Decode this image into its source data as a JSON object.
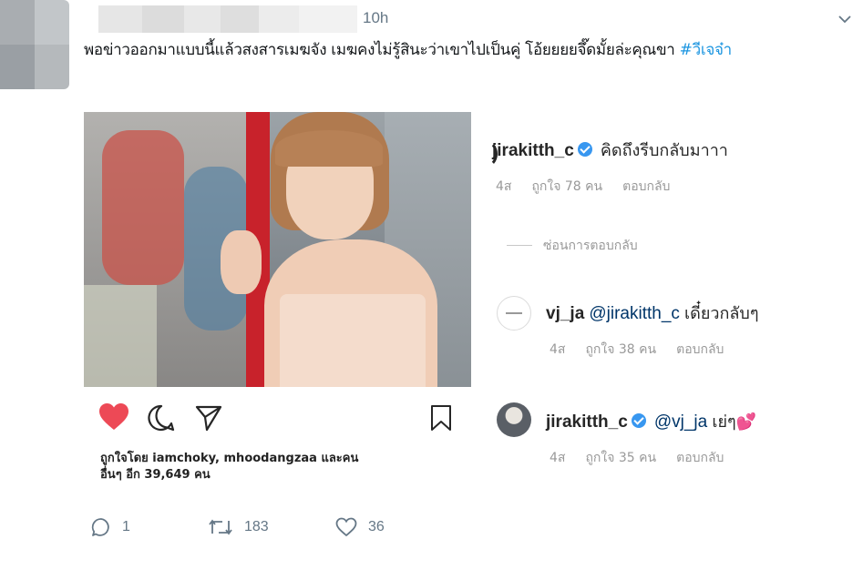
{
  "tweet": {
    "time": "10h",
    "text": "พอข่าวออกมาแบบนี้แล้วสงสารเมฆจัง เมฆคงไม่รู้สินะว่าเขาไปเป็นคู่ โอ้ยยยยจึ๊ดมั้ยล่ะคุณขา ",
    "hashtag": "#วีเจจ๋า",
    "reply_count": "1",
    "retweet_count": "183",
    "like_count": "36"
  },
  "instagram": {
    "likes_line1": "ถูกใจโดย iamchoky, mhoodangzaa และคน",
    "likes_line2": "อื่นๆ อีก 39,649 คน",
    "comments": [
      {
        "user": "jirakitth_c",
        "verified": true,
        "mention": "",
        "text": "คิดถึงรีบกลับมาาา",
        "age": "4ส",
        "likes": "ถูกใจ 78 คน",
        "reply": "ตอบกลับ"
      },
      {
        "user": "vj_ja",
        "verified": false,
        "mention": "@jirakitth_c",
        "text": "เดี๋ยวกลับๆ",
        "age": "4ส",
        "likes": "ถูกใจ 38 คน",
        "reply": "ตอบกลับ"
      },
      {
        "user": "jirakitth_c",
        "verified": true,
        "mention": "@vj_ja",
        "text": "เย่ๆ💕",
        "age": "4ส",
        "likes": "ถูกใจ 35 คน",
        "reply": "ตอบกลับ"
      }
    ],
    "hide_replies": "ซ่อนการตอบกลับ"
  },
  "icons": {
    "like": "heart-icon",
    "comment": "comment-icon",
    "share": "send-icon",
    "save": "bookmark-icon",
    "chevron": "chevron-down-icon",
    "reply": "reply-icon",
    "retweet": "retweet-icon",
    "tweet_like": "like-outline-icon"
  },
  "colors": {
    "ig_heart": "#ed4956",
    "verified": "#3897f0",
    "hashtag": "#1b95e0",
    "muted": "#657786"
  }
}
